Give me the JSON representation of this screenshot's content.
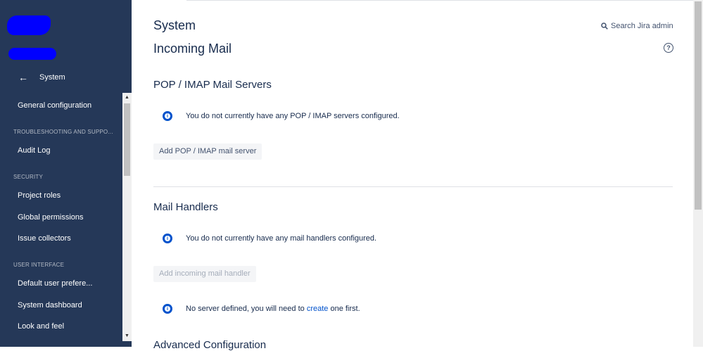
{
  "sidebar": {
    "back_label": "System",
    "back_icon": "arrow-left-icon",
    "items": [
      {
        "type": "item",
        "label": "General configuration"
      },
      {
        "type": "heading",
        "label": "TROUBLESHOOTING AND SUPPO..."
      },
      {
        "type": "item",
        "label": "Audit Log"
      },
      {
        "type": "heading",
        "label": "SECURITY"
      },
      {
        "type": "item",
        "label": "Project roles"
      },
      {
        "type": "item",
        "label": "Global permissions"
      },
      {
        "type": "item",
        "label": "Issue collectors"
      },
      {
        "type": "heading",
        "label": "USER INTERFACE"
      },
      {
        "type": "item",
        "label": "Default user prefere..."
      },
      {
        "type": "item",
        "label": "System dashboard"
      },
      {
        "type": "item",
        "label": "Look and feel"
      }
    ]
  },
  "header": {
    "breadcrumb": "System",
    "title": "Incoming Mail",
    "search_label": "Search Jira admin"
  },
  "pop_imap": {
    "heading": "POP / IMAP Mail Servers",
    "message": "You do not currently have any POP / IMAP servers configured.",
    "button": "Add POP / IMAP mail server"
  },
  "mail_handlers": {
    "heading": "Mail Handlers",
    "message": "You do not currently have any mail handlers configured.",
    "button": "Add incoming mail handler",
    "note_pre": "No server defined, you will need to ",
    "note_link": "create",
    "note_post": " one first."
  },
  "advanced": {
    "heading": "Advanced Configuration"
  },
  "colors": {
    "sidebar_bg": "#253858",
    "accent": "#0052cc"
  }
}
